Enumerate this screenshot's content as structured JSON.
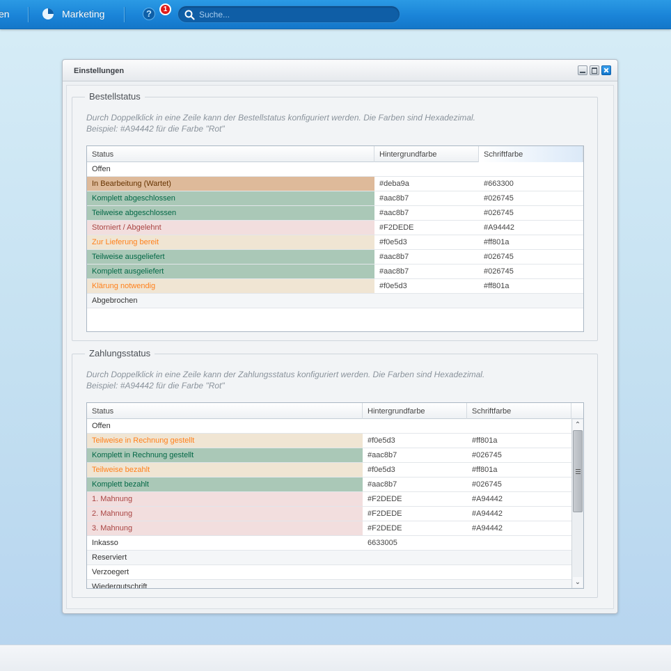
{
  "topbar": {
    "partial_left_label": "en",
    "marketing_label": "Marketing",
    "help_glyph": "?",
    "notification_count": "1",
    "search_placeholder": "Suche..."
  },
  "window": {
    "title": "Einstellungen"
  },
  "order_status": {
    "legend": "Bestellstatus",
    "hint_line1": "Durch Doppelklick in eine Zeile kann der Bestellstatus konfiguriert werden. Die Farben sind Hexadezimal.",
    "hint_line2": "Beispiel: #A94442 für die Farbe \"Rot\"",
    "columns": [
      "Status",
      "Hintergrundfarbe",
      "Schriftfarbe"
    ],
    "rows": [
      {
        "status": "Offen",
        "bg": "",
        "fg": "",
        "bg_color": "",
        "fg_color": ""
      },
      {
        "status": "In Bearbeitung (Wartet)",
        "bg": "#deba9a",
        "fg": "#663300",
        "bg_color": "#deba9a",
        "fg_color": "#663300"
      },
      {
        "status": "Komplett abgeschlossen",
        "bg": "#aac8b7",
        "fg": "#026745",
        "bg_color": "#aac8b7",
        "fg_color": "#026745"
      },
      {
        "status": "Teilweise abgeschlossen",
        "bg": "#aac8b7",
        "fg": "#026745",
        "bg_color": "#aac8b7",
        "fg_color": "#026745"
      },
      {
        "status": "Storniert / Abgelehnt",
        "bg": "#F2DEDE",
        "fg": "#A94442",
        "bg_color": "#F2DEDE",
        "fg_color": "#A94442"
      },
      {
        "status": "Zur Lieferung bereit",
        "bg": "#f0e5d3",
        "fg": "#ff801a",
        "bg_color": "#f0e5d3",
        "fg_color": "#ff801a"
      },
      {
        "status": "Teilweise ausgeliefert",
        "bg": "#aac8b7",
        "fg": "#026745",
        "bg_color": "#aac8b7",
        "fg_color": "#026745"
      },
      {
        "status": "Komplett ausgeliefert",
        "bg": "#aac8b7",
        "fg": "#026745",
        "bg_color": "#aac8b7",
        "fg_color": "#026745"
      },
      {
        "status": "Klärung notwendig",
        "bg": "#f0e5d3",
        "fg": "#ff801a",
        "bg_color": "#f0e5d3",
        "fg_color": "#ff801a"
      },
      {
        "status": "Abgebrochen",
        "bg": "",
        "fg": "",
        "bg_color": "",
        "fg_color": ""
      }
    ]
  },
  "payment_status": {
    "legend": "Zahlungsstatus",
    "hint_line1": "Durch Doppelklick in eine Zeile kann der Zahlungsstatus konfiguriert werden. Die Farben sind Hexadezimal.",
    "hint_line2": "Beispiel: #A94442 für die Farbe \"Rot\"",
    "columns": [
      "Status",
      "Hintergrundfarbe",
      "Schriftfarbe"
    ],
    "rows": [
      {
        "status": "Offen",
        "bg": "",
        "fg": "",
        "bg_color": "",
        "fg_color": ""
      },
      {
        "status": "Teilweise in Rechnung gestellt",
        "bg": "#f0e5d3",
        "fg": "#ff801a",
        "bg_color": "#f0e5d3",
        "fg_color": "#ff801a"
      },
      {
        "status": "Komplett in Rechnung gestellt",
        "bg": "#aac8b7",
        "fg": "#026745",
        "bg_color": "#aac8b7",
        "fg_color": "#026745"
      },
      {
        "status": "Teilweise bezahlt",
        "bg": "#f0e5d3",
        "fg": "#ff801a",
        "bg_color": "#f0e5d3",
        "fg_color": "#ff801a"
      },
      {
        "status": "Komplett bezahlt",
        "bg": "#aac8b7",
        "fg": "#026745",
        "bg_color": "#aac8b7",
        "fg_color": "#026745"
      },
      {
        "status": "1. Mahnung",
        "bg": "#F2DEDE",
        "fg": "#A94442",
        "bg_color": "#F2DEDE",
        "fg_color": "#A94442"
      },
      {
        "status": "2. Mahnung",
        "bg": "#F2DEDE",
        "fg": "#A94442",
        "bg_color": "#F2DEDE",
        "fg_color": "#A94442"
      },
      {
        "status": "3. Mahnung",
        "bg": "#F2DEDE",
        "fg": "#A94442",
        "bg_color": "#F2DEDE",
        "fg_color": "#A94442"
      },
      {
        "status": "Inkasso",
        "bg": "6633005",
        "fg": "",
        "bg_color": "",
        "fg_color": ""
      },
      {
        "status": "Reserviert",
        "bg": "",
        "fg": "",
        "bg_color": "",
        "fg_color": ""
      },
      {
        "status": "Verzoegert",
        "bg": "",
        "fg": "",
        "bg_color": "",
        "fg_color": ""
      },
      {
        "status": "Wiedergutschrift",
        "bg": "",
        "fg": "",
        "bg_color": "",
        "fg_color": ""
      }
    ]
  },
  "icons": {
    "chart": "pie-chart-icon",
    "help": "help-icon",
    "search": "search-icon",
    "scroll_up": "chevron-up-icon",
    "scroll_down": "chevron-down-icon"
  },
  "colors": {
    "topbar": "#1a84d8",
    "badge": "#e01b1b",
    "close_button": "#1276cc"
  }
}
